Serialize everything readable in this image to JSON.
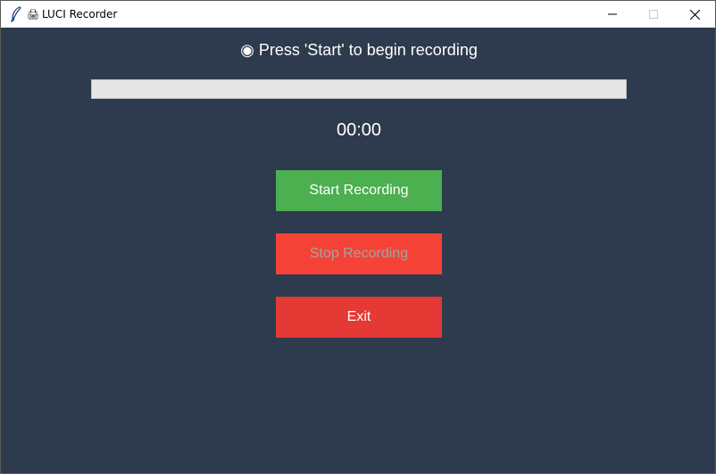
{
  "window": {
    "title": "LUCI Recorder",
    "title_glyph": "🖨"
  },
  "status": {
    "text": "◉ Press 'Start' to begin recording"
  },
  "progress": {
    "value_percent": 0
  },
  "timer": {
    "text": "00:00"
  },
  "buttons": {
    "start_label": "Start Recording",
    "stop_label": "Stop Recording",
    "exit_label": "Exit"
  },
  "colors": {
    "background": "#2e3a4d",
    "start": "#4caf50",
    "stop": "#f44336",
    "exit": "#e53935"
  }
}
